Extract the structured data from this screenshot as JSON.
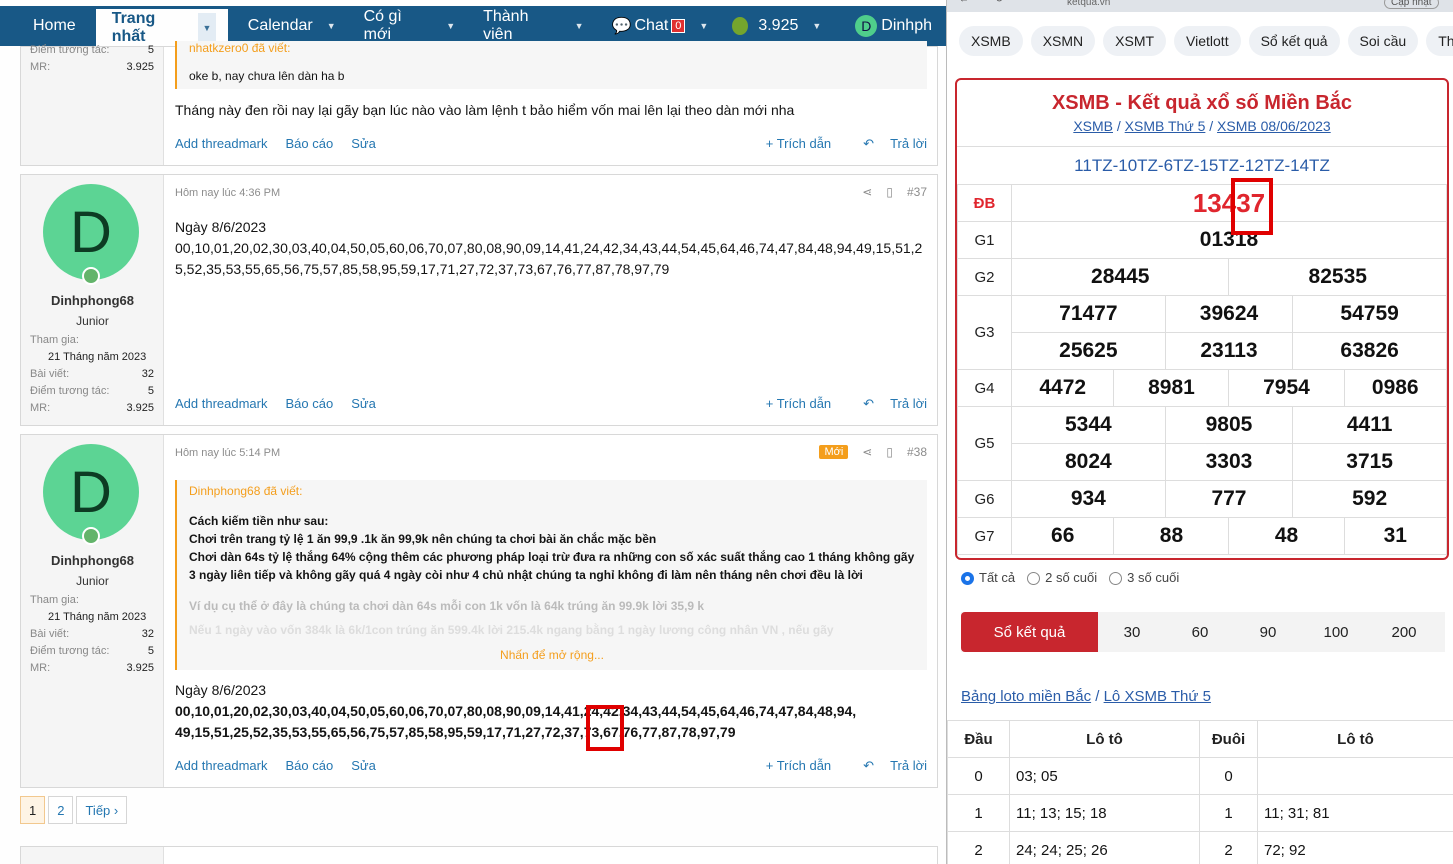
{
  "nav": {
    "home": "Home",
    "trang_nhat": "Trang nhất",
    "calendar": "Calendar",
    "co_gi_moi": "Có gì mới",
    "thanh_vien": "Thành viên",
    "chat": "Chat",
    "chat_count": "0",
    "points": "3.925",
    "avatar_letter": "D",
    "user": "Dinhph"
  },
  "post0": {
    "stat1_label": "Điểm tương tác:",
    "stat1_value": "5",
    "stat2_label": "MR:",
    "stat2_value": "3.925",
    "quote_author": "nhatkzero0 đã viết:",
    "quote_text": "oke b, nay chưa lên dàn ha b",
    "text": "Tháng này đen rồi nay lại gãy bạn lúc nào vào làm lệnh t bảo hiểm vốn mai lên lại theo dàn mới nha"
  },
  "actions": {
    "threadmark": "Add threadmark",
    "report": "Báo cáo",
    "edit": "Sửa",
    "quote": "+ Trích dẫn",
    "reply": "Trả lời"
  },
  "post37": {
    "avatar_letter": "D",
    "username": "Dinhphong68",
    "role": "Junior",
    "join_label": "Tham gia:",
    "join_value": "21 Tháng năm 2023",
    "posts_label": "Bài viết:",
    "posts_value": "32",
    "score_label": "Điểm tương tác:",
    "score_value": "5",
    "mr_label": "MR:",
    "mr_value": "3.925",
    "time": "Hôm nay lúc 4:36 PM",
    "number": "#37",
    "date": "Ngày 8/6/2023",
    "numbers": "00,10,01,20,02,30,03,40,04,50,05,60,06,70,07,80,08,90,09,14,41,24,42,34,43,44,54,45,64,46,74,47,84,48,94,49,15,51,25,52,35,53,55,65,56,75,57,85,58,95,59,17,71,27,72,37,73,67,76,77,87,78,97,79"
  },
  "post38": {
    "avatar_letter": "D",
    "username": "Dinhphong68",
    "role": "Junior",
    "join_label": "Tham gia:",
    "join_value": "21 Tháng năm 2023",
    "posts_label": "Bài viết:",
    "posts_value": "32",
    "score_label": "Điểm tương tác:",
    "score_value": "5",
    "mr_label": "MR:",
    "mr_value": "3.925",
    "time": "Hôm nay lúc 5:14 PM",
    "new_badge": "Mới",
    "number": "#38",
    "quote_author": "Dinhphong68 đã viết:",
    "quote_lines": [
      "Cách kiếm tiền như sau:",
      "Chơi trên trang tỷ lệ 1 ăn 99,9 .1k ăn 99,9k nên chúng ta chơi bài ăn chắc mặc bền",
      "Chơi dàn 64s tỷ lệ thắng 64% cộng thêm các phương pháp loại trừ đưa ra những con số xác suất thắng cao 1 tháng không gãy 3 ngày liên tiếp và không gãy quá 4 ngày còi như 4 chủ nhật chúng ta nghỉ không đi làm nên tháng nên chơi đều là lời"
    ],
    "quote_fade1": "Ví dụ cụ thể ở đây là chúng ta chơi dàn 64s mỗi con 1k vốn là 64k trúng ăn 99.9k lời 35,9 k",
    "quote_fade2": "Nếu 1 ngày vào vốn 384k là 6k/1con trúng ăn 599.4k lời 215.4k ngang bằng 1 ngày lương công nhân VN , nếu gãy",
    "expand": "Nhấn để mở rộng...",
    "date": "Ngày 8/6/2023",
    "numbers_line1": "00,10,01,20,02,30,03,40,04,50,05,60,06,70,07,80,08,90,09,14,41,24,42,34,43,44,54,45,64,46,74,47,84,48,94,",
    "numbers_line2": "49,15,51,25,52,35,53,55,65,56,75,57,85,58,95,59,17,71,27,72,37,73,67,76,77,87,78,97,79"
  },
  "pager": {
    "p1": "1",
    "p2": "2",
    "next": "Tiếp ›"
  },
  "browser": {
    "url": "ketqua.vn",
    "update": "Cập nhật"
  },
  "tabs": [
    "XSMB",
    "XSMN",
    "XSMT",
    "Vietlott",
    "Sổ kết quả",
    "Soi cầu",
    "Th"
  ],
  "result": {
    "title": "XSMB - Kết quả xổ số Miền Bắc",
    "crumb1": "XSMB",
    "crumb2": "XSMB Thứ 5",
    "crumb3": "XSMB 08/06/2023",
    "sep": "/",
    "codes": "11TZ-10TZ-6TZ-15TZ-12TZ-14TZ",
    "labels": [
      "ĐB",
      "G1",
      "G2",
      "G3",
      "G4",
      "G5",
      "G6",
      "G7"
    ],
    "db": "13437",
    "g1": "01318",
    "g2": [
      "28445",
      "82535"
    ],
    "g3": [
      "71477",
      "39624",
      "54759",
      "25625",
      "23113",
      "63826"
    ],
    "g4": [
      "4472",
      "8981",
      "7954",
      "0986"
    ],
    "g5": [
      "5344",
      "9805",
      "4411",
      "8024",
      "3303",
      "3715"
    ],
    "g6": [
      "934",
      "777",
      "592"
    ],
    "g7": [
      "66",
      "88",
      "48",
      "31"
    ]
  },
  "options": {
    "all": "Tất cả",
    "two": "2 số cuối",
    "three": "3 số cuối"
  },
  "selector": {
    "main": "Sổ kết quả",
    "values": [
      "30",
      "60",
      "90",
      "100",
      "200"
    ]
  },
  "loto_link": {
    "a": "Bảng loto miền Bắc",
    "sep": "/",
    "b": "Lô XSMB Thứ 5"
  },
  "loto": {
    "headers": [
      "Đầu",
      "Lô tô",
      "Đuôi",
      "Lô tô"
    ],
    "rows": [
      [
        "0",
        "03; 05",
        "0",
        ""
      ],
      [
        "1",
        "11; 13; 15; 18",
        "1",
        "11; 31; 81"
      ],
      [
        "2",
        "24; 24; 25; 26",
        "2",
        "72; 92"
      ]
    ]
  }
}
